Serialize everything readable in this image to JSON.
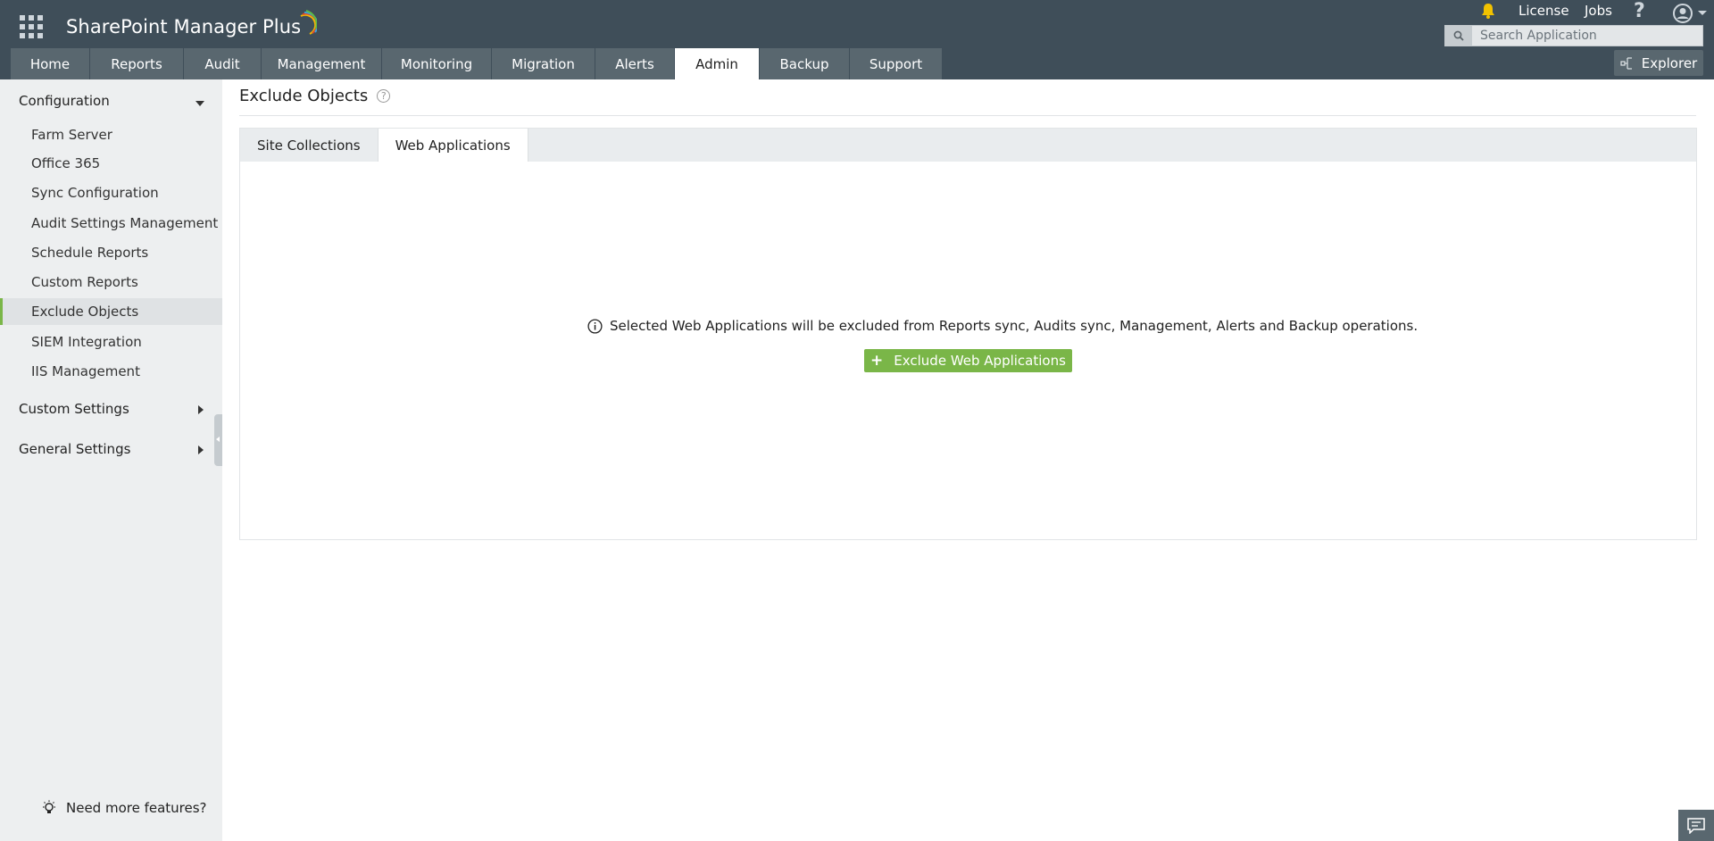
{
  "app": {
    "name": "SharePoint Manager Plus"
  },
  "topbar": {
    "license_label": "License",
    "jobs_label": "Jobs",
    "help_label": "?",
    "search_placeholder": "Search Application"
  },
  "nav": {
    "tabs": [
      {
        "label": "Home"
      },
      {
        "label": "Reports"
      },
      {
        "label": "Audit"
      },
      {
        "label": "Management"
      },
      {
        "label": "Monitoring"
      },
      {
        "label": "Migration"
      },
      {
        "label": "Alerts"
      },
      {
        "label": "Admin",
        "active": true
      },
      {
        "label": "Backup"
      },
      {
        "label": "Support"
      }
    ],
    "explorer_label": "Explorer"
  },
  "sidebar": {
    "configuration_label": "Configuration",
    "items": [
      {
        "label": "Farm Server"
      },
      {
        "label": "Office 365"
      },
      {
        "label": "Sync Configuration"
      },
      {
        "label": "Audit Settings Management"
      },
      {
        "label": "Schedule Reports"
      },
      {
        "label": "Custom Reports"
      },
      {
        "label": "Exclude Objects",
        "active": true
      },
      {
        "label": "SIEM Integration"
      },
      {
        "label": "IIS Management"
      }
    ],
    "custom_settings_label": "Custom Settings",
    "general_settings_label": "General Settings",
    "need_more_label": "Need more features?"
  },
  "main": {
    "page_title": "Exclude Objects",
    "help_icon": "?",
    "tabs": [
      {
        "label": "Site Collections"
      },
      {
        "label": "Web Applications",
        "active": true
      }
    ],
    "info_text": "Selected Web Applications will be excluded from Reports sync, Audits sync, Management, Alerts and Backup operations.",
    "exclude_button_label": "Exclude Web Applications"
  },
  "colors": {
    "header_bg": "#3f4e59",
    "tab_bg": "#59676f",
    "accent_green": "#7ab648",
    "sidebar_bg": "#edeff0"
  }
}
